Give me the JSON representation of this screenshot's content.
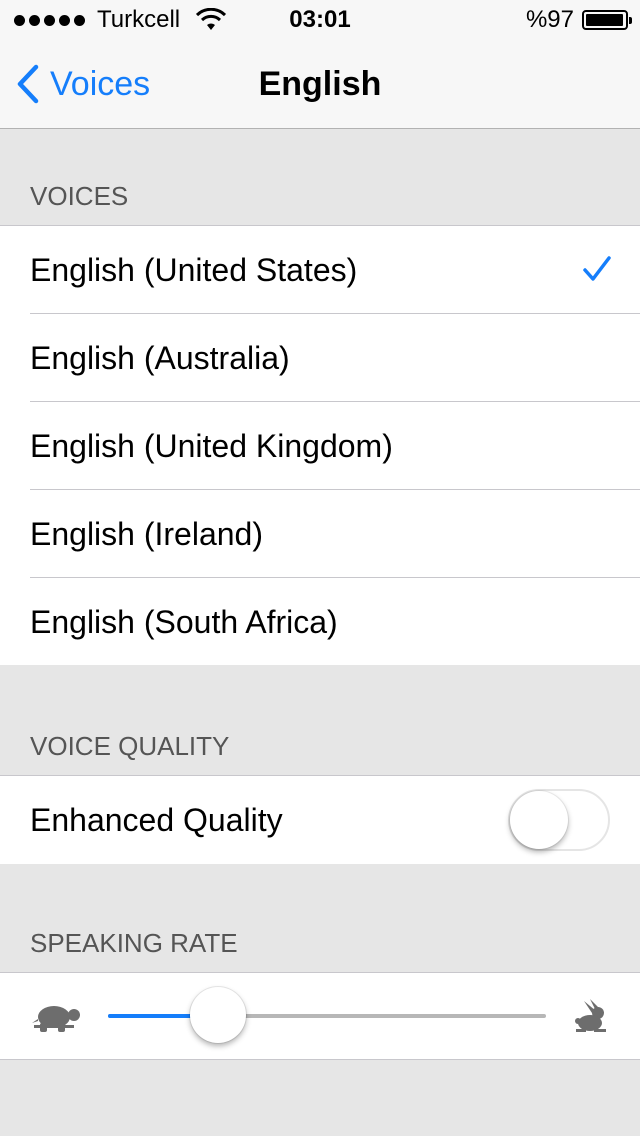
{
  "status_bar": {
    "carrier": "Turkcell",
    "time": "03:01",
    "battery_text": "%97",
    "battery_level": 0.97,
    "signal_icon": "signal-dots-icon",
    "wifi_icon": "wifi-icon",
    "battery_icon": "battery-icon"
  },
  "nav": {
    "back_label": "Voices",
    "back_icon": "chevron-left-icon",
    "title": "English"
  },
  "voices_section": {
    "header": "VOICES",
    "items": [
      {
        "label": "English (United States)",
        "selected": true
      },
      {
        "label": "English (Australia)",
        "selected": false
      },
      {
        "label": "English (United Kingdom)",
        "selected": false
      },
      {
        "label": "English (Ireland)",
        "selected": false
      },
      {
        "label": "English (South Africa)",
        "selected": false
      }
    ]
  },
  "quality_section": {
    "header": "VOICE QUALITY",
    "enhanced_label": "Enhanced Quality",
    "enhanced_on": false
  },
  "rate_section": {
    "header": "SPEAKING RATE",
    "rate_value": 0.25,
    "slow_icon": "turtle-icon",
    "fast_icon": "rabbit-icon"
  },
  "colors": {
    "accent": "#157efb",
    "section_bg": "#e6e6e6",
    "header_text": "#555555"
  }
}
